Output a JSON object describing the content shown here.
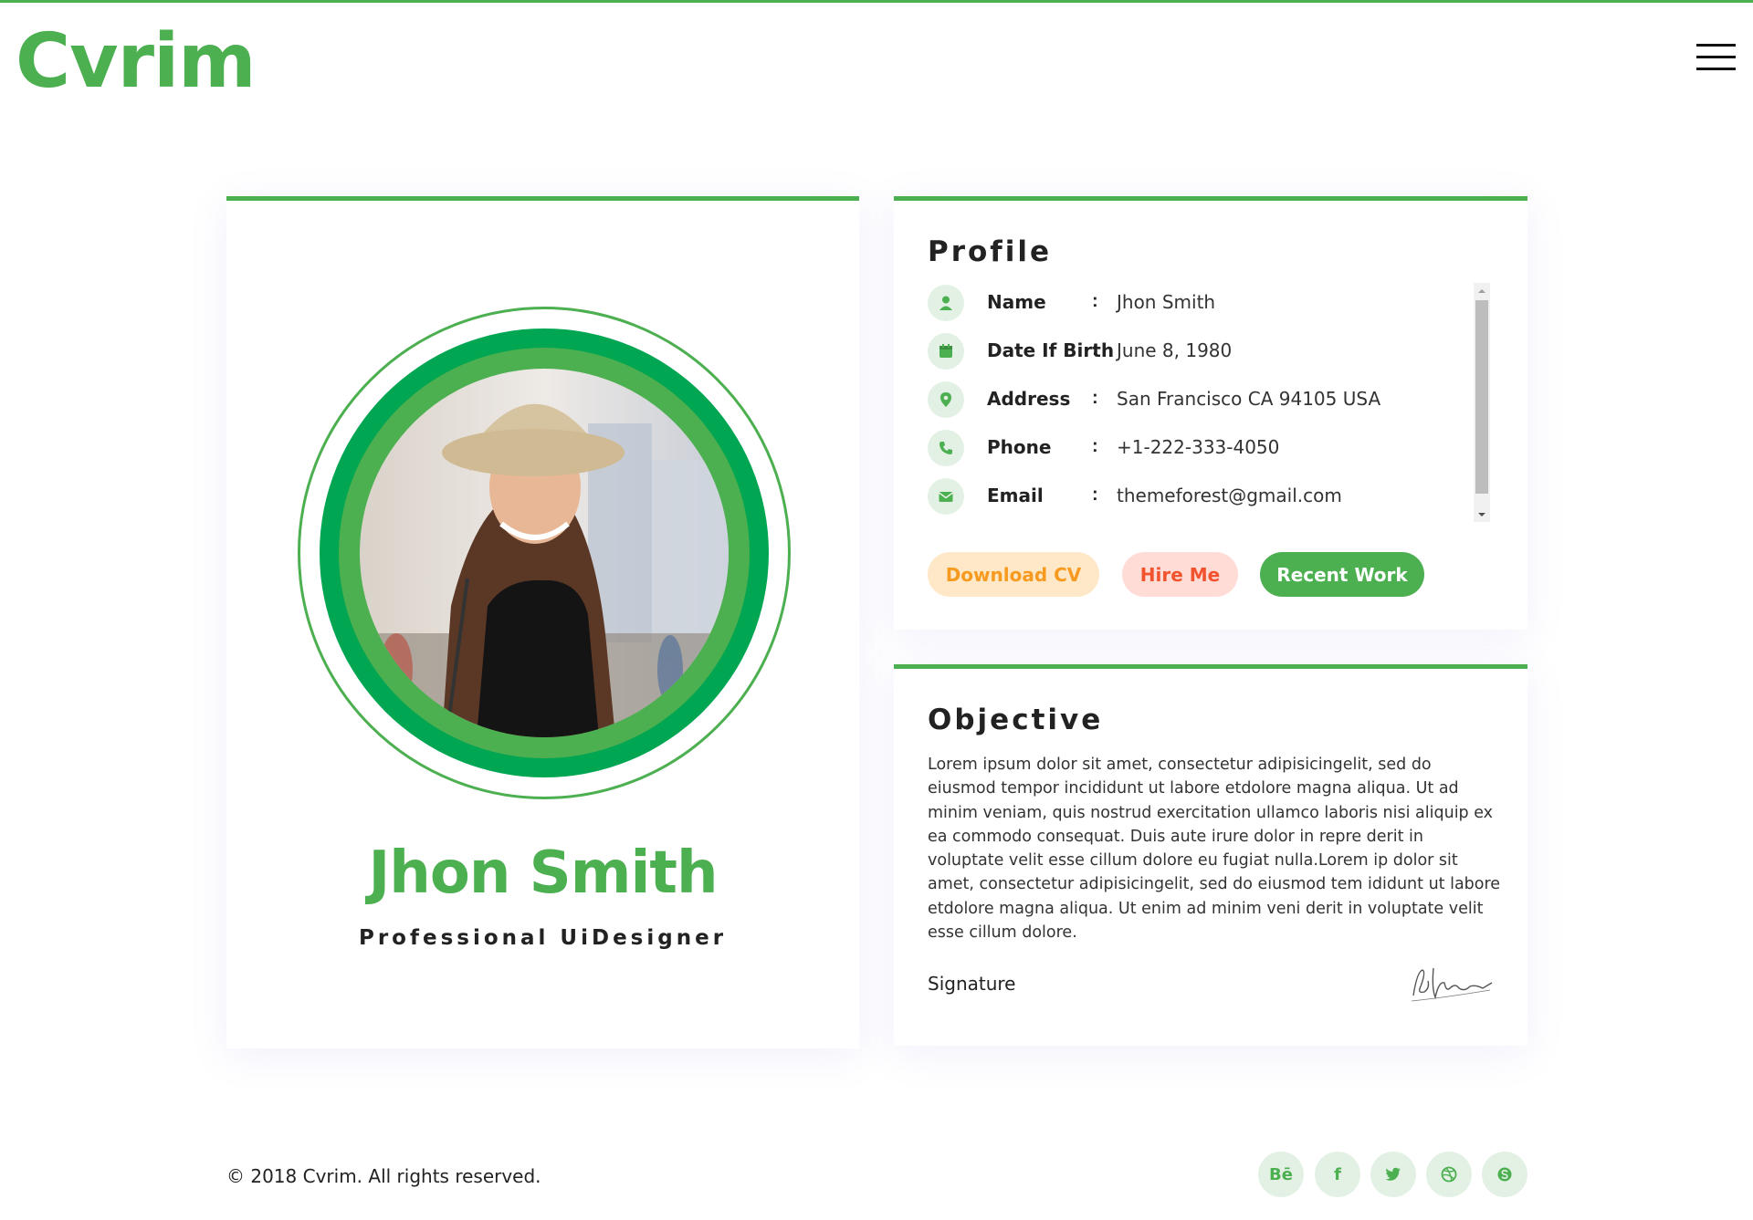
{
  "brand": {
    "logo_text": "Cvrim",
    "accent_color": "#4caf50"
  },
  "header": {
    "menu_icon": "hamburger-menu-icon"
  },
  "person": {
    "name": "Jhon Smith",
    "role": "Professional UiDesigner",
    "photo": "profile-photo"
  },
  "profile": {
    "title": "Profile",
    "rows": [
      {
        "icon": "user-icon",
        "label": "Name",
        "value": "Jhon Smith"
      },
      {
        "icon": "calendar-icon",
        "label": "Date If Birth",
        "value": "June 8, 1980"
      },
      {
        "icon": "map-pin-icon",
        "label": "Address",
        "value": "San Francisco CA 94105 USA"
      },
      {
        "icon": "phone-icon",
        "label": "Phone",
        "value": "+1-222-333-4050"
      },
      {
        "icon": "envelope-icon",
        "label": "Email",
        "value": "themeforest@gmail.com"
      }
    ],
    "separator": ":",
    "buttons": {
      "download": "Download CV",
      "hire": "Hire Me",
      "recent": "Recent Work"
    }
  },
  "objective": {
    "title": "Objective",
    "text": "Lorem ipsum dolor sit amet, consectetur adipisicingelit, sed do eiusmod tempor incididunt ut labore etdolore magna aliqua. Ut ad minim veniam, quis nostrud exercitation ullamco laboris nisi aliquip ex ea commodo consequat. Duis aute irure dolor in repre derit in voluptate velit esse cillum dolore eu fugiat nulla.Lorem ip dolor sit amet, consectetur adipisicingelit, sed do eiusmod tem ididunt ut labore etdolore magna aliqua. Ut enim ad minim veni derit in voluptate velit esse cillum dolore.",
    "signature_label": "Signature"
  },
  "footer": {
    "copyright": "© 2018 Cvrim. All rights reserved.",
    "social": [
      {
        "icon": "behance-icon",
        "label": "Bē"
      },
      {
        "icon": "facebook-icon",
        "label": "f"
      },
      {
        "icon": "twitter-icon",
        "label": ""
      },
      {
        "icon": "dribbble-icon",
        "label": ""
      },
      {
        "icon": "skype-icon",
        "label": ""
      }
    ]
  }
}
